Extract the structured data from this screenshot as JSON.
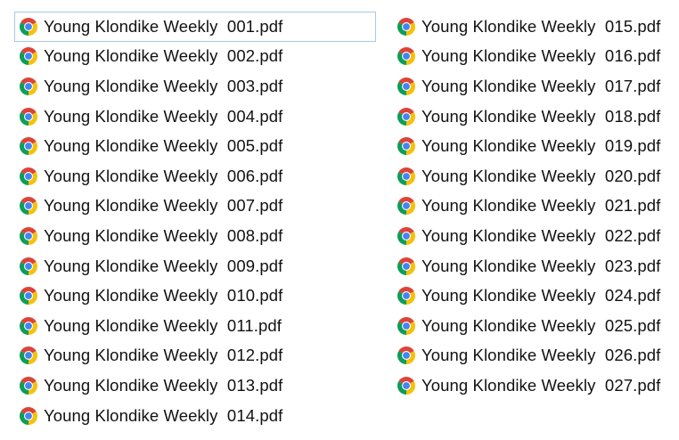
{
  "theme": {
    "text_color": "#111111",
    "focus_border_color": "#a8c8e8",
    "icon": "chrome-pdf-icon",
    "icon_colors": {
      "red": "#db4437",
      "yellow": "#f4c20d",
      "green": "#0f9d58",
      "blue": "#4285f4"
    }
  },
  "files": {
    "column_left": [
      {
        "name": "Young Klondike Weekly  001.pdf"
      },
      {
        "name": "Young Klondike Weekly  002.pdf"
      },
      {
        "name": "Young Klondike Weekly  003.pdf"
      },
      {
        "name": "Young Klondike Weekly  004.pdf"
      },
      {
        "name": "Young Klondike Weekly  005.pdf"
      },
      {
        "name": "Young Klondike Weekly  006.pdf"
      },
      {
        "name": "Young Klondike Weekly  007.pdf"
      },
      {
        "name": "Young Klondike Weekly  008.pdf"
      },
      {
        "name": "Young Klondike Weekly  009.pdf"
      },
      {
        "name": "Young Klondike Weekly  010.pdf"
      },
      {
        "name": "Young Klondike Weekly  011.pdf"
      },
      {
        "name": "Young Klondike Weekly  012.pdf"
      },
      {
        "name": "Young Klondike Weekly  013.pdf"
      },
      {
        "name": "Young Klondike Weekly  014.pdf"
      }
    ],
    "column_right": [
      {
        "name": "Young Klondike Weekly  015.pdf"
      },
      {
        "name": "Young Klondike Weekly  016.pdf"
      },
      {
        "name": "Young Klondike Weekly  017.pdf"
      },
      {
        "name": "Young Klondike Weekly  018.pdf"
      },
      {
        "name": "Young Klondike Weekly  019.pdf"
      },
      {
        "name": "Young Klondike Weekly  020.pdf"
      },
      {
        "name": "Young Klondike Weekly  021.pdf"
      },
      {
        "name": "Young Klondike Weekly  022.pdf"
      },
      {
        "name": "Young Klondike Weekly  023.pdf"
      },
      {
        "name": "Young Klondike Weekly  024.pdf"
      },
      {
        "name": "Young Klondike Weekly  025.pdf"
      },
      {
        "name": "Young Klondike Weekly  026.pdf"
      },
      {
        "name": "Young Klondike Weekly  027.pdf"
      }
    ]
  }
}
